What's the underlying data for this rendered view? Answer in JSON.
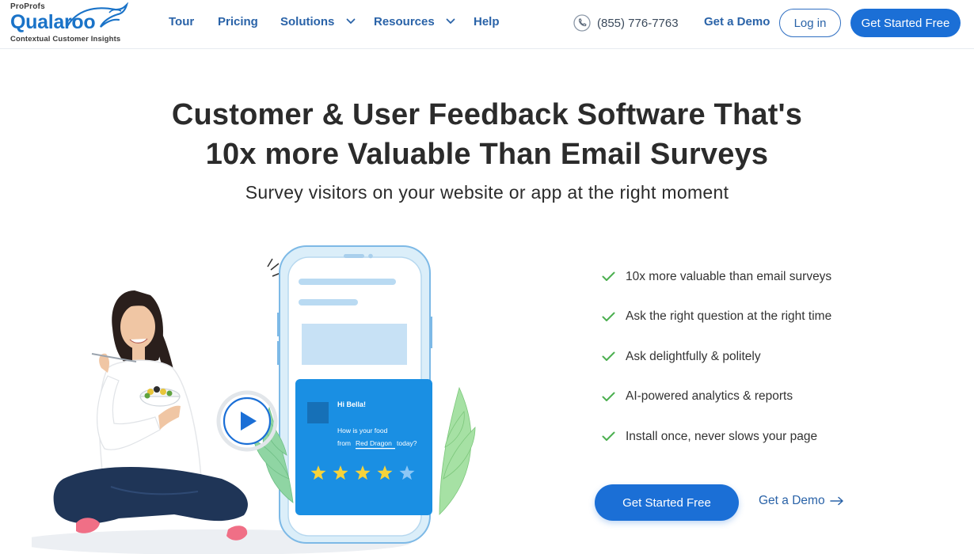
{
  "brand": {
    "parent": "ProProfs",
    "name": "Qualaroo",
    "tagline": "Contextual Customer Insights"
  },
  "nav": {
    "items": [
      {
        "label": "Tour"
      },
      {
        "label": "Pricing"
      },
      {
        "label": "Solutions"
      },
      {
        "label": "Resources"
      },
      {
        "label": "Help"
      }
    ],
    "phone": "(855) 776-7763",
    "demo_label": "Get a Demo",
    "login_label": "Log in",
    "started_label": "Get Started Free"
  },
  "hero": {
    "title_line1": "Customer & User Feedback Software That's",
    "title_line2": "10x more Valuable Than Email Surveys",
    "subtitle": "Survey visitors on your website or app at the right moment"
  },
  "survey_card": {
    "greeting": "Hi Bella!",
    "question_line1": "How is your food",
    "question_prefix": "from",
    "question_link": "Red Dragon",
    "question_suffix": "today?",
    "rating": 4,
    "max_rating": 5
  },
  "features": [
    "10x more valuable than email surveys",
    "Ask the right question at the right time",
    "Ask delightfully & politely",
    "AI-powered analytics & reports",
    "Install once, never slows your page"
  ],
  "cta": {
    "primary_label": "Get Started Free",
    "secondary_label": "Get a Demo"
  },
  "colors": {
    "accent": "#1b6fd6",
    "nav_text": "#2a63a8",
    "check": "#4caf50",
    "star_active": "#f7d33a",
    "star_inactive": "#8ec7f5"
  }
}
